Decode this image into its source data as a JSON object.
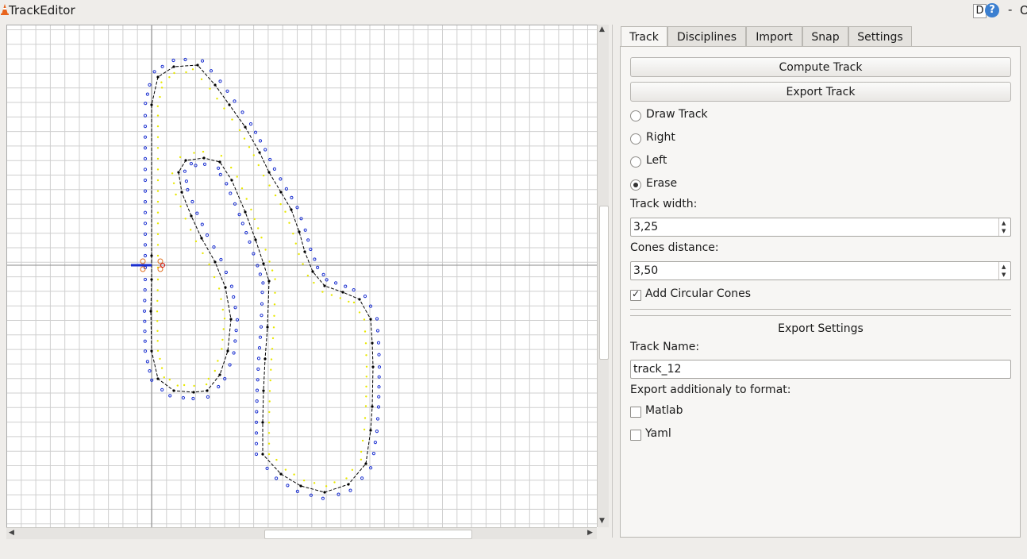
{
  "window": {
    "title": "TrackEditor",
    "d_button": "D",
    "help_button": "?",
    "minimize": "-",
    "close_partial": "O"
  },
  "tabs": [
    "Track",
    "Disciplines",
    "Import",
    "Snap",
    "Settings"
  ],
  "active_tab": "Track",
  "track_panel": {
    "compute_button": "Compute Track",
    "export_button": "Export Track",
    "modes": [
      {
        "label": "Draw Track",
        "selected": false
      },
      {
        "label": "Right",
        "selected": false
      },
      {
        "label": "Left",
        "selected": false
      },
      {
        "label": "Erase",
        "selected": true
      }
    ],
    "track_width_label": "Track width:",
    "track_width_value": "3,25",
    "cones_distance_label": "Cones distance:",
    "cones_distance_value": "3,50",
    "circular_cones_label": "Add Circular Cones",
    "circular_cones_checked": true
  },
  "export_settings": {
    "heading": "Export Settings",
    "track_name_label": "Track Name:",
    "track_name_value": "track_12",
    "formats_label": "Export additionaly to format:",
    "formats": [
      {
        "label": "Matlab",
        "checked": false
      },
      {
        "label": "Yaml",
        "checked": false
      }
    ]
  },
  "canvas": {
    "colors": {
      "grid": "#cfcfcf",
      "axis": "#8a8a8a",
      "centerline": "#000000",
      "blue_cones": "#1a2fd0",
      "yellow_cones": "#e8e800",
      "orange_cones": "#e07020",
      "start_line": "#1a2fd0",
      "start_marker": "#cc0000"
    }
  }
}
